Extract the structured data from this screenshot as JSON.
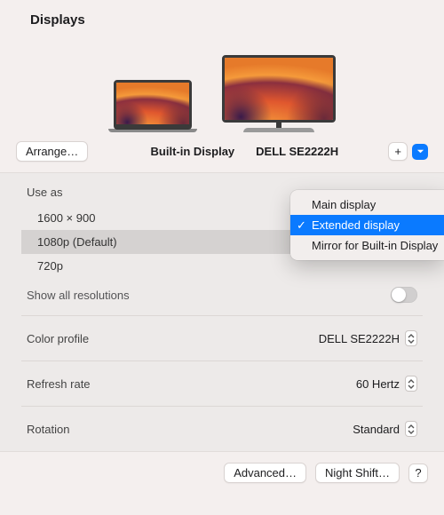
{
  "title": "Displays",
  "arrange_label": "Arrange…",
  "display_labels": {
    "builtin": "Built-in Display",
    "external": "DELL SE2222H"
  },
  "add_button_label": "+",
  "use_as_label": "Use as",
  "resolutions": [
    "1600 × 900",
    "1080p (Default)",
    "720p"
  ],
  "show_all_label": "Show all resolutions",
  "rows": {
    "color_profile": {
      "label": "Color profile",
      "value": "DELL SE2222H"
    },
    "refresh_rate": {
      "label": "Refresh rate",
      "value": "60 Hertz"
    },
    "rotation": {
      "label": "Rotation",
      "value": "Standard"
    }
  },
  "footer": {
    "advanced": "Advanced…",
    "night_shift": "Night Shift…",
    "help": "?"
  },
  "popover": {
    "items": [
      "Main display",
      "Extended display",
      "Mirror for Built-in Display"
    ],
    "selected_index": 1
  }
}
